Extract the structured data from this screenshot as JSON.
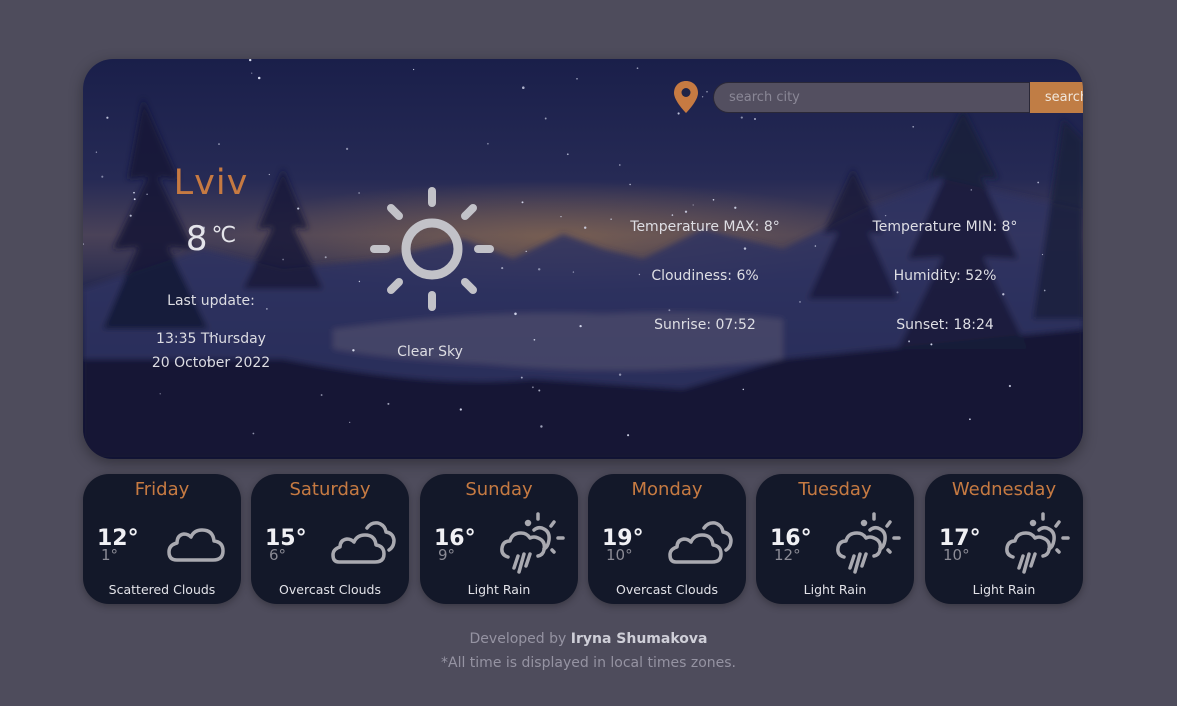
{
  "search": {
    "placeholder": "search city",
    "value": "",
    "button_label": "search",
    "location_icon": "map-pin-icon"
  },
  "current": {
    "city": "Lviv",
    "temperature": "8",
    "unit": "℃",
    "last_update_label": "Last update:",
    "time_day": "13:35 Thursday",
    "date": "20 October 2022",
    "icon": "sun-icon",
    "description": "Clear Sky"
  },
  "stats": {
    "temp_max": "Temperature MAX: 8°",
    "temp_min": "Temperature MIN: 8°",
    "cloudiness": "Cloudiness: 6%",
    "humidity": "Humidity: 52%",
    "sunrise": "Sunrise: 07:52",
    "sunset": "Sunset: 18:24"
  },
  "forecast": [
    {
      "day": "Friday",
      "max": "12°",
      "min": "1°",
      "icon": "cloud-icon",
      "desc": "Scattered Clouds"
    },
    {
      "day": "Saturday",
      "max": "15°",
      "min": "6°",
      "icon": "clouds-icon",
      "desc": "Overcast Clouds"
    },
    {
      "day": "Sunday",
      "max": "16°",
      "min": "9°",
      "icon": "rain-sun-icon",
      "desc": "Light Rain"
    },
    {
      "day": "Monday",
      "max": "19°",
      "min": "10°",
      "icon": "clouds-icon",
      "desc": "Overcast Clouds"
    },
    {
      "day": "Tuesday",
      "max": "16°",
      "min": "12°",
      "icon": "rain-sun-icon",
      "desc": "Light Rain"
    },
    {
      "day": "Wednesday",
      "max": "17°",
      "min": "10°",
      "icon": "rain-sun-icon",
      "desc": "Light Rain"
    }
  ],
  "footer": {
    "developed_by": "Developed by ",
    "author": "Iryna Shumakova",
    "note": "*All time is displayed in local times zones."
  },
  "colors": {
    "accent": "#c67a42",
    "button": "#c07d45",
    "page_bg": "#4e4c5c",
    "card_bg": "#131829"
  }
}
